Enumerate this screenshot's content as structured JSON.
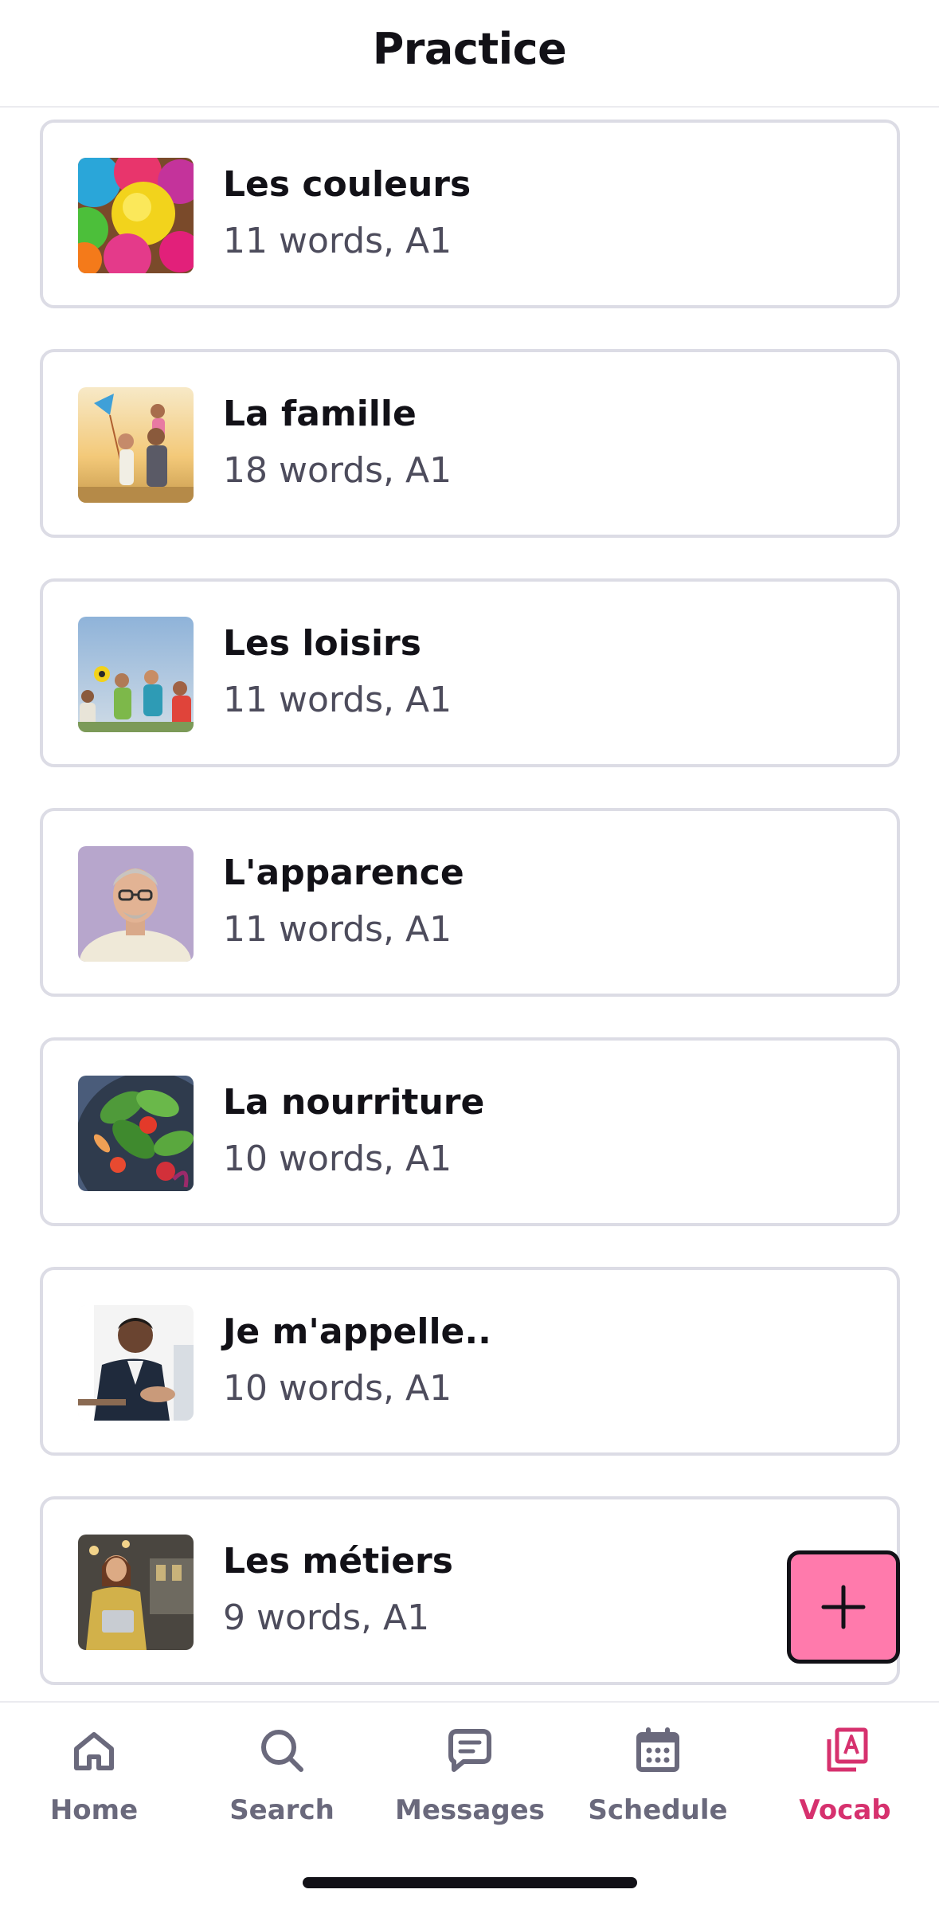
{
  "header": {
    "title": "Practice"
  },
  "decks": [
    {
      "title": "Les couleurs",
      "subtitle": "11 words, A1",
      "image": "colored-powder-photo"
    },
    {
      "title": "La famille",
      "subtitle": "18 words, A1",
      "image": "family-kite-photo"
    },
    {
      "title": "Les loisirs",
      "subtitle": "11 words, A1",
      "image": "friends-playing-photo"
    },
    {
      "title": "L'apparence",
      "subtitle": "11 words, A1",
      "image": "man-portrait-photo"
    },
    {
      "title": "La nourriture",
      "subtitle": "10 words, A1",
      "image": "salad-photo"
    },
    {
      "title": "Je m'appelle..",
      "subtitle": "10 words, A1",
      "image": "handshake-photo"
    },
    {
      "title": "Les métiers",
      "subtitle": "9 words, A1",
      "image": "waitress-photo"
    }
  ],
  "fab": {
    "icon": "plus-icon"
  },
  "tabbar": {
    "tabs": [
      {
        "label": "Home",
        "icon": "home-icon",
        "active": false
      },
      {
        "label": "Search",
        "icon": "search-icon",
        "active": false
      },
      {
        "label": "Messages",
        "icon": "message-icon",
        "active": false
      },
      {
        "label": "Schedule",
        "icon": "calendar-icon",
        "active": false
      },
      {
        "label": "Vocab",
        "icon": "vocab-cards-icon",
        "active": true
      }
    ]
  },
  "colors": {
    "accent": "#ff7aac",
    "active_tab": "#d6316e",
    "inactive_tab": "#6a697c",
    "card_border": "#dcdce5"
  }
}
